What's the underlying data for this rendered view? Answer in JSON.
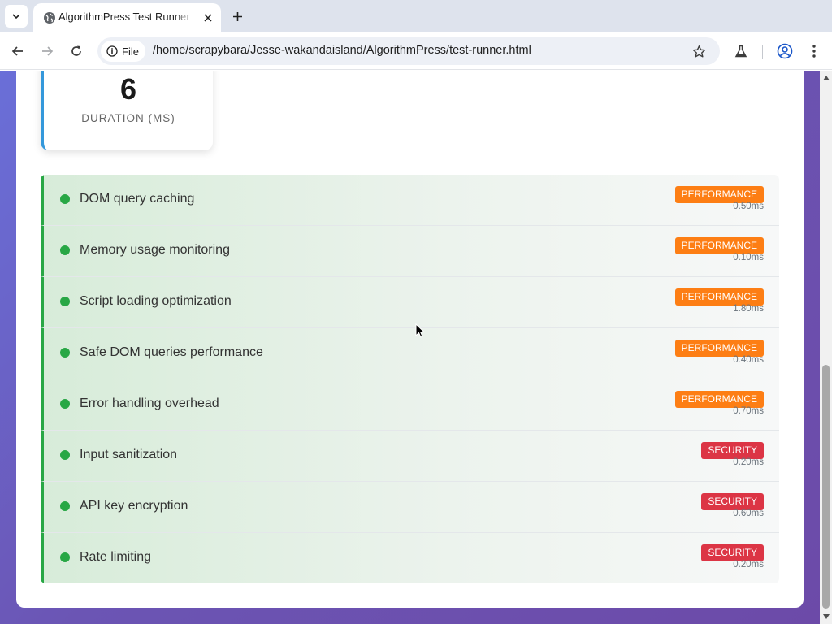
{
  "browser": {
    "tab_title": "AlgorithmPress Test Runner",
    "file_chip": "File",
    "url": "/home/scrapybara/Jesse-wakandaisland/AlgorithmPress/test-runner.html"
  },
  "stat": {
    "value": "6",
    "label": "Duration (ms)",
    "accent": "#3498db"
  },
  "results": [
    {
      "name": "DOM query caching",
      "category": "performance",
      "category_label": "Performance",
      "duration": "0.50ms"
    },
    {
      "name": "Memory usage monitoring",
      "category": "performance",
      "category_label": "Performance",
      "duration": "0.10ms"
    },
    {
      "name": "Script loading optimization",
      "category": "performance",
      "category_label": "Performance",
      "duration": "1.80ms"
    },
    {
      "name": "Safe DOM queries performance",
      "category": "performance",
      "category_label": "Performance",
      "duration": "0.40ms"
    },
    {
      "name": "Error handling overhead",
      "category": "performance",
      "category_label": "Performance",
      "duration": "0.70ms"
    },
    {
      "name": "Input sanitization",
      "category": "security",
      "category_label": "Security",
      "duration": "0.20ms"
    },
    {
      "name": "API key encryption",
      "category": "security",
      "category_label": "Security",
      "duration": "0.60ms"
    },
    {
      "name": "Rate limiting",
      "category": "security",
      "category_label": "Security",
      "duration": "0.20ms"
    }
  ],
  "colors": {
    "pass": "#28a745",
    "performance": "#fd7e14",
    "security": "#dc3545"
  },
  "icons": [
    "tab-search-icon",
    "globe-icon",
    "close-icon",
    "plus-icon",
    "back-arrow-icon",
    "forward-arrow-icon",
    "reload-icon",
    "info-icon",
    "star-icon",
    "labs-flask-icon",
    "profile-icon",
    "kebab-menu-icon",
    "mouse-cursor-icon"
  ]
}
